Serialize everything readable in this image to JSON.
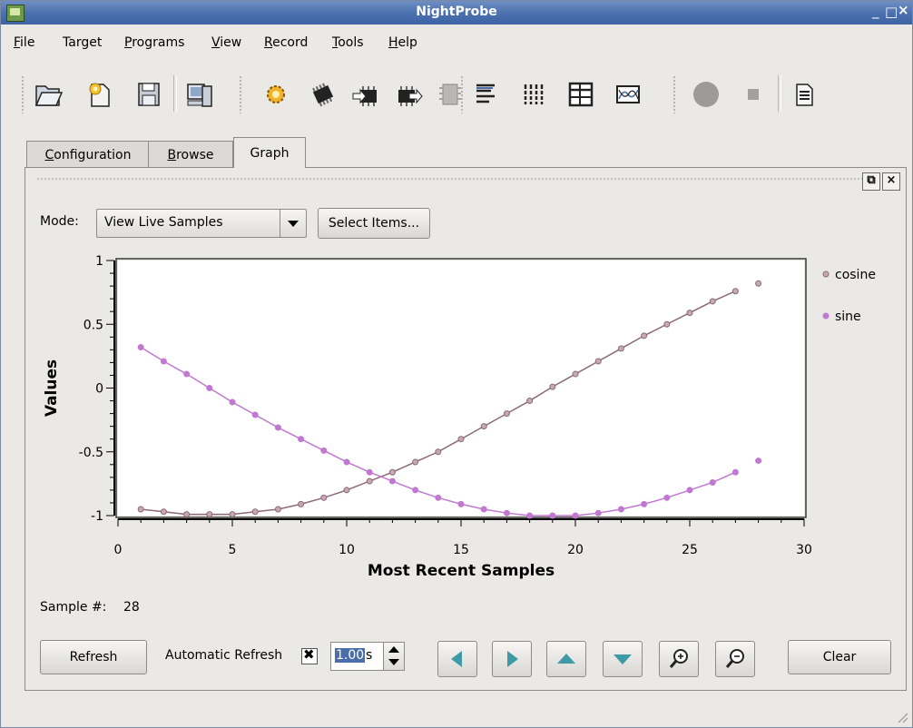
{
  "window": {
    "title": "NightProbe"
  },
  "menu": [
    {
      "label": "File",
      "key": "F",
      "rest": "ile"
    },
    {
      "label": "Target",
      "key": "",
      "rest": "Target"
    },
    {
      "label": "Programs",
      "key": "P",
      "rest": "rograms"
    },
    {
      "label": "View",
      "key": "V",
      "rest": "iew"
    },
    {
      "label": "Record",
      "key": "R",
      "rest": "ecord"
    },
    {
      "label": "Tools",
      "key": "T",
      "rest": "ools"
    },
    {
      "label": "Help",
      "key": "H",
      "rest": "elp"
    }
  ],
  "toolbar": {
    "icons": [
      "open-folder-icon",
      "new-file-icon",
      "save-disk-icon",
      "computer-icon",
      "gear-icon",
      "chip-icon",
      "chip-arrow-icon",
      "chip-export-icon",
      "chip-disabled-icon",
      "align-left-icon",
      "columns-icon",
      "table-icon",
      "graph-icon",
      "record-icon",
      "stop-icon",
      "document-icon"
    ]
  },
  "tabs": [
    {
      "label": "Configuration",
      "key": "C",
      "rest": "onfiguration"
    },
    {
      "label": "Browse",
      "key": "B",
      "rest": "rowse"
    },
    {
      "label": "Graph",
      "key": "",
      "rest": "Graph"
    }
  ],
  "graph": {
    "mode_label": "Mode:",
    "mode_value": "View Live Samples",
    "select_items": "Select Items...",
    "sample_label": "Sample #:",
    "sample_value": "28",
    "refresh": "Refresh",
    "auto_refresh_label": "Automatic Refresh",
    "auto_refresh_checked": true,
    "interval_value": "1.00",
    "interval_unit": "s",
    "clear": "Clear",
    "nav_icons": [
      "arrow-left-icon",
      "arrow-right-icon",
      "arrow-up-icon",
      "arrow-down-icon",
      "zoom-in-icon",
      "zoom-out-icon"
    ]
  },
  "chart_data": {
    "type": "line",
    "xlabel": "Most Recent Samples",
    "ylabel": "Values",
    "xlim": [
      0,
      30
    ],
    "ylim": [
      -1,
      1
    ],
    "xticks": [
      0,
      5,
      10,
      15,
      20,
      25,
      30
    ],
    "yticks": [
      1,
      0.5,
      0,
      -0.5,
      -1
    ],
    "legend_position": "right",
    "series": [
      {
        "name": "cosine",
        "color": "#8a6a78",
        "x": [
          1,
          2,
          3,
          4,
          5,
          6,
          7,
          8,
          9,
          10,
          11,
          12,
          13,
          14,
          15,
          16,
          17,
          18,
          19,
          20,
          21,
          22,
          23,
          24,
          25,
          26,
          27,
          28
        ],
        "y": [
          -0.95,
          -0.97,
          -0.99,
          -0.99,
          -0.99,
          -0.97,
          -0.95,
          -0.91,
          -0.86,
          -0.8,
          -0.73,
          -0.66,
          -0.58,
          -0.5,
          -0.4,
          -0.3,
          -0.2,
          -0.1,
          0.01,
          0.11,
          0.21,
          0.31,
          0.41,
          0.5,
          0.59,
          0.68,
          0.76,
          0.82
        ]
      },
      {
        "name": "sine",
        "color": "#c078d0",
        "x": [
          1,
          2,
          3,
          4,
          5,
          6,
          7,
          8,
          9,
          10,
          11,
          12,
          13,
          14,
          15,
          16,
          17,
          18,
          19,
          20,
          21,
          22,
          23,
          24,
          25,
          26,
          27,
          28
        ],
        "y": [
          0.32,
          0.21,
          0.11,
          0.0,
          -0.11,
          -0.21,
          -0.31,
          -0.4,
          -0.49,
          -0.58,
          -0.66,
          -0.73,
          -0.8,
          -0.86,
          -0.91,
          -0.95,
          -0.98,
          -1.0,
          -1.0,
          -1.0,
          -0.98,
          -0.95,
          -0.91,
          -0.86,
          -0.8,
          -0.74,
          -0.66,
          -0.57
        ]
      }
    ]
  }
}
